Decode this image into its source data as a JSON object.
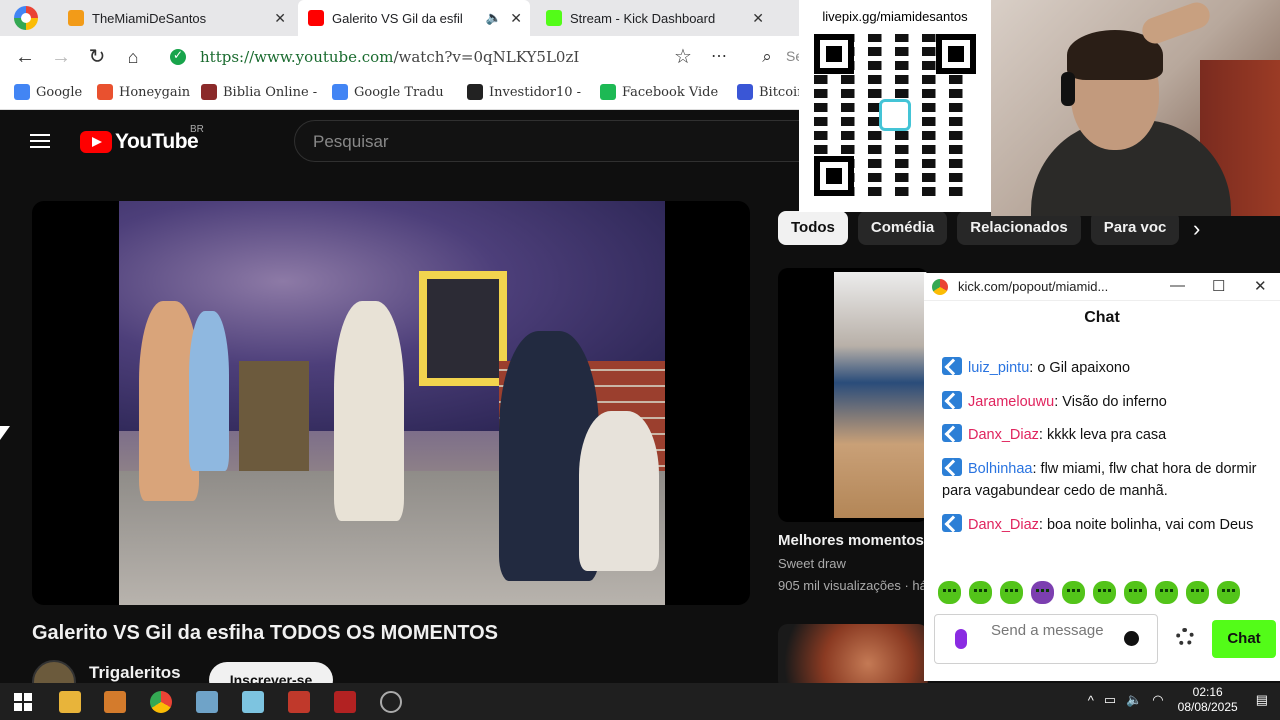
{
  "browser": {
    "tabs": [
      {
        "title": "TheMiamiDeSantos",
        "favicon_color": "#f29b18",
        "active": false
      },
      {
        "title": "Galerito VS Gil da esfil",
        "favicon_color": "#ff0000",
        "active": true
      },
      {
        "title": "Stream - Kick Dashboard",
        "favicon_color": "#53fc18",
        "active": false
      }
    ],
    "url": {
      "prefix": "https://www.youtube.com",
      "rest": "/watch?v=0qNLKY5L0zI"
    },
    "search_stub": "Se",
    "bookmarks": [
      {
        "label": "Google",
        "color": "#4285f4"
      },
      {
        "label": "Honeygain",
        "color": "#e9512f"
      },
      {
        "label": "Biblia Online -",
        "color": "#8b2a2a"
      },
      {
        "label": "Google Tradu",
        "color": "#4285f4"
      },
      {
        "label": "Investidor10 -",
        "color": "#222222"
      },
      {
        "label": "Facebook Vide",
        "color": "#1db954"
      },
      {
        "label": "Bitcoin",
        "color": "#3a56d6"
      }
    ]
  },
  "youtube": {
    "logo_text": "YouTube",
    "region": "BR",
    "search_placeholder": "Pesquisar",
    "video_title": "Galerito VS Gil da esfiha TODOS OS MOMENTOS",
    "channel_name": "Trigaleritos",
    "subscribe_label": "Inscrever-se",
    "chips": [
      "Todos",
      "Comédia",
      "Relacionados",
      "Para voc"
    ],
    "recommendation": {
      "title": "Melhores momentos",
      "channel": "Sweet draw",
      "meta": "905 mil visualizações · há"
    }
  },
  "overlay": {
    "qr_label": "livepix.gg/miamidesantos"
  },
  "chat": {
    "window_url": "kick.com/popout/miamid...",
    "header": "Chat",
    "messages": [
      {
        "user": "luiz_pintu",
        "color": "#2a74e0",
        "text": ": o Gil apaixono"
      },
      {
        "user": "Jaramelouwu",
        "color": "#e0245e",
        "text": ": Visão do inferno"
      },
      {
        "user": "Danx_Diaz",
        "color": "#e0245e",
        "text": ": kkkk leva pra casa"
      },
      {
        "user": "Bolhinhaa",
        "color": "#2a74e0",
        "text": ": flw miami, flw chat hora de dormir para vagabundear cedo de manhã."
      },
      {
        "user": "Danx_Diaz",
        "color": "#e0245e",
        "text": ": boa noite bolinha, vai com Deus"
      }
    ],
    "input_placeholder": "Send a message",
    "send_label": "Chat",
    "accent": "#53fc18"
  },
  "taskbar": {
    "time": "02:16",
    "date": "08/08/2025"
  }
}
